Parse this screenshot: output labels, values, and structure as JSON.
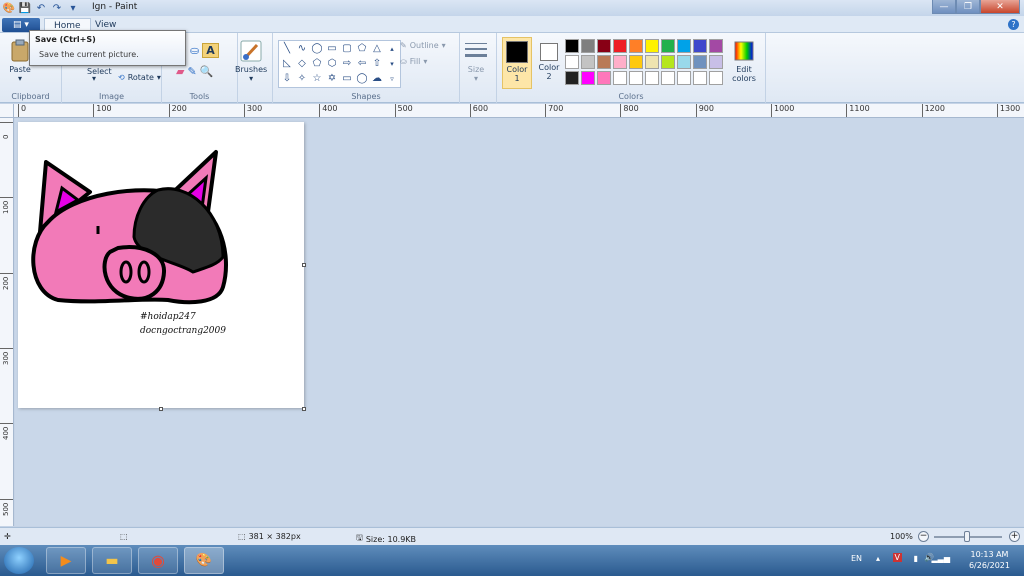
{
  "window": {
    "title": "Ign - Paint"
  },
  "tabs": {
    "home": "Home",
    "view": "View"
  },
  "tooltip": {
    "title": "Save (Ctrl+S)",
    "description": "Save the current picture."
  },
  "clipboard": {
    "paste": "Paste",
    "label": "Clipboard"
  },
  "image": {
    "select": "Select",
    "rotate": "Rotate",
    "label": "Image"
  },
  "tools": {
    "label": "Tools"
  },
  "brushes": {
    "label": "Brushes"
  },
  "shapes": {
    "outline": "Outline",
    "fill": "Fill",
    "label": "Shapes"
  },
  "size": {
    "label": "Size"
  },
  "colors": {
    "color1": "Color",
    "color1_num": "1",
    "color2": "Color",
    "color2_num": "2",
    "edit": "Edit",
    "edit2": "colors",
    "label": "Colors",
    "color1_value": "#000000",
    "color2_value": "#ffffff",
    "palette": [
      "#000000",
      "#7f7f7f",
      "#880015",
      "#ed1c24",
      "#ff7f27",
      "#fff200",
      "#22b14c",
      "#00a2e8",
      "#3f48cc",
      "#a349a4",
      "#ffffff",
      "#c3c3c3",
      "#b97a57",
      "#ffaec9",
      "#ffc90e",
      "#efe4b0",
      "#b5e61d",
      "#99d9ea",
      "#7092be",
      "#c8bfe7",
      "#222222",
      "#ff00ff",
      "#ff77bb",
      "#ffffff",
      "#ffffff",
      "#ffffff",
      "#ffffff",
      "#ffffff",
      "#ffffff",
      "#ffffff"
    ]
  },
  "rulers": {
    "h": [
      "0",
      "100",
      "200",
      "300",
      "400",
      "500",
      "600",
      "700",
      "800",
      "900",
      "1000",
      "1100",
      "1200",
      "1300"
    ],
    "v": [
      "0",
      "100",
      "200",
      "300",
      "400",
      "500"
    ]
  },
  "canvas": {
    "signature_line1": "#hoidap247",
    "signature_line2": "docngoctrang2009",
    "pink": "#f27ab8",
    "magenta": "#e600e6",
    "black_patch": "#2b2b2b"
  },
  "status": {
    "dimensions": "381 × 382px",
    "size": "Size: 10.9KB",
    "zoom": "100%"
  },
  "taskbar": {
    "lang": "EN",
    "time": "10:13 AM",
    "date": "6/26/2021"
  }
}
